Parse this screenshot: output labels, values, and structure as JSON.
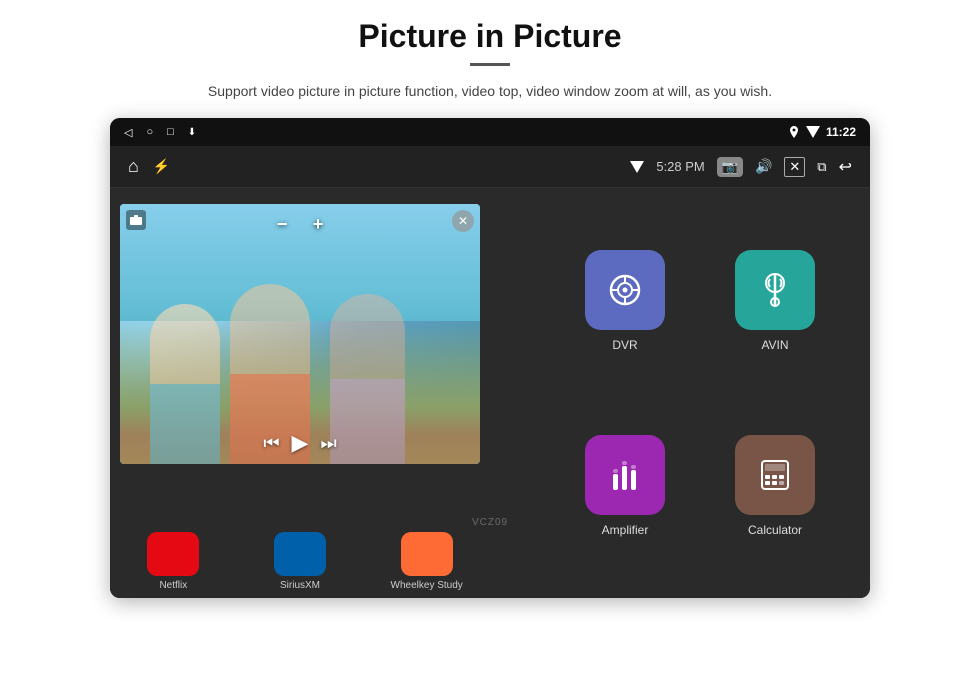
{
  "header": {
    "title": "Picture in Picture",
    "subtitle": "Support video picture in picture function, video top, video window zoom at will, as you wish."
  },
  "device": {
    "status_bar": {
      "back_icon": "◁",
      "home_icon": "○",
      "recents_icon": "□",
      "download_icon": "⬇",
      "signal_icon": "▼",
      "wifi_icon": "▼",
      "time": "11:22"
    },
    "nav_bar": {
      "home_icon": "⌂",
      "usb_icon": "⚡",
      "wifi_icon": "▼",
      "time_label": "5:28 PM",
      "camera_icon": "📷",
      "volume_icon": "🔊",
      "close_icon": "✕",
      "pip_icon": "⧉",
      "back_icon": "↩"
    }
  },
  "pip_controls": {
    "camera_label": "📷",
    "minus_label": "−",
    "plus_label": "+",
    "close_label": "✕",
    "prev_label": "⏮",
    "play_label": "▶",
    "next_label": "⏭"
  },
  "top_apps": [
    {
      "color": "#4CAF50",
      "label": ""
    },
    {
      "color": "#E91E8C",
      "label": ""
    },
    {
      "color": "#9C27B0",
      "label": ""
    }
  ],
  "bottom_apps": [
    {
      "label": "Netflix",
      "color": "#E50914"
    },
    {
      "label": "SiriusXM",
      "color": "#0060A9"
    },
    {
      "label": "Wheelkey Study",
      "color": "#FF6B35"
    }
  ],
  "right_apps": [
    {
      "label": "DVR",
      "bg_color": "#5C6BC0",
      "icon_type": "dvr"
    },
    {
      "label": "AVIN",
      "bg_color": "#26A69A",
      "icon_type": "avin"
    },
    {
      "label": "Amplifier",
      "bg_color": "#9C27B0",
      "icon_type": "amplifier"
    },
    {
      "label": "Calculator",
      "bg_color": "#795548",
      "icon_type": "calculator"
    }
  ],
  "watermark": "VCZ09"
}
